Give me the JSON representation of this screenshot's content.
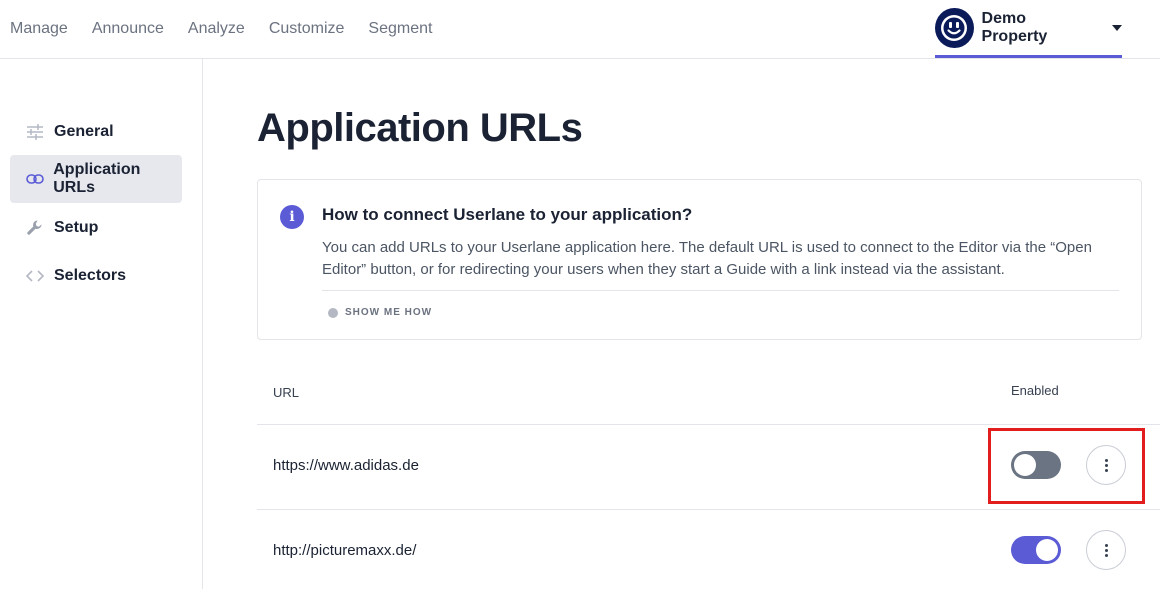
{
  "topnav": {
    "items": [
      "Manage",
      "Announce",
      "Analyze",
      "Customize",
      "Segment"
    ],
    "property_name": "Demo Property"
  },
  "sidebar": {
    "items": [
      {
        "label": "General",
        "icon": "sliders-icon",
        "active": false
      },
      {
        "label": "Application URLs",
        "icon": "link-icon",
        "active": true
      },
      {
        "label": "Setup",
        "icon": "wrench-icon",
        "active": false
      },
      {
        "label": "Selectors",
        "icon": "code-icon",
        "active": false
      }
    ]
  },
  "main": {
    "title": "Application URLs",
    "info": {
      "title": "How to connect Userlane to your application?",
      "body": "You can add URLs to your Userlane application here. The default URL is used to connect to the Editor via the “Open Editor” button, or for redirecting your users when they start a Guide with a link instead via the assistant.",
      "show_me_label": "SHOW ME HOW"
    },
    "table": {
      "col_url": "URL",
      "col_enabled": "Enabled",
      "rows": [
        {
          "url": "https://www.adidas.de",
          "enabled": false
        },
        {
          "url": "http://picturemaxx.de/",
          "enabled": true
        }
      ]
    }
  },
  "colors": {
    "accent": "#5b5bd6",
    "toggle_off": "#6b7483",
    "highlight": "#e11d1d",
    "avatar_bg": "#0b1b5a"
  }
}
